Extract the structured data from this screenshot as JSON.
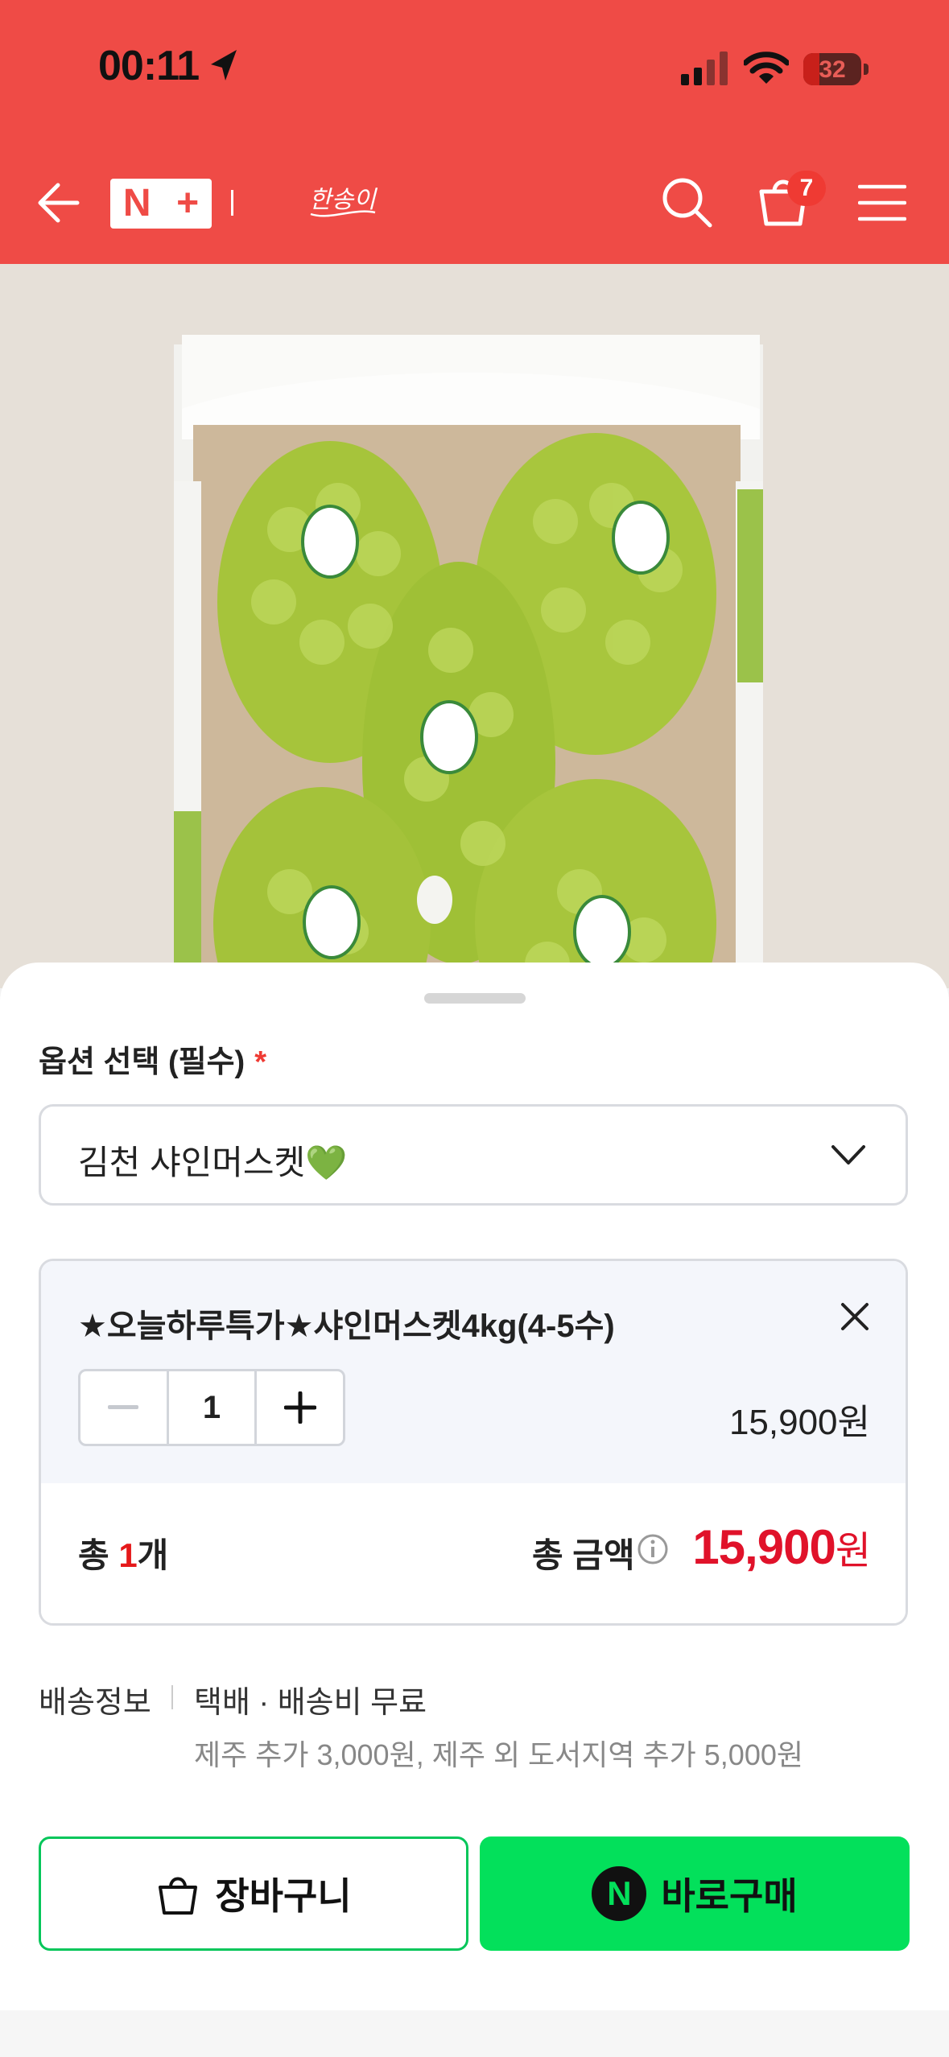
{
  "status_bar": {
    "time": "00:11",
    "battery": "32"
  },
  "header": {
    "brand_logo_text": "한송이",
    "cart_count": "7"
  },
  "option": {
    "label": "옵션 선택 (필수)",
    "required_mark": "*",
    "selected": "김천 샤인머스켓💚"
  },
  "item": {
    "name": "★오늘하루특가★샤인머스켓4kg(4-5수)",
    "quantity": "1",
    "price": "15,900원"
  },
  "total": {
    "count_prefix": "총 ",
    "count": "1",
    "count_suffix": "개",
    "amount_label": "총 금액",
    "amount": "15,900",
    "amount_unit": "원"
  },
  "shipping": {
    "label": "배송정보",
    "value": "택배 · 배송비 무료",
    "extra": "제주 추가 3,000원, 제주 외 도서지역 추가 5,000원"
  },
  "buttons": {
    "cart": "장바구니",
    "buy": "바로구매",
    "buy_badge": "N"
  },
  "colors": {
    "accent": "#ef4b46",
    "buy_green": "#03e05b",
    "price_red": "#e0122a"
  }
}
